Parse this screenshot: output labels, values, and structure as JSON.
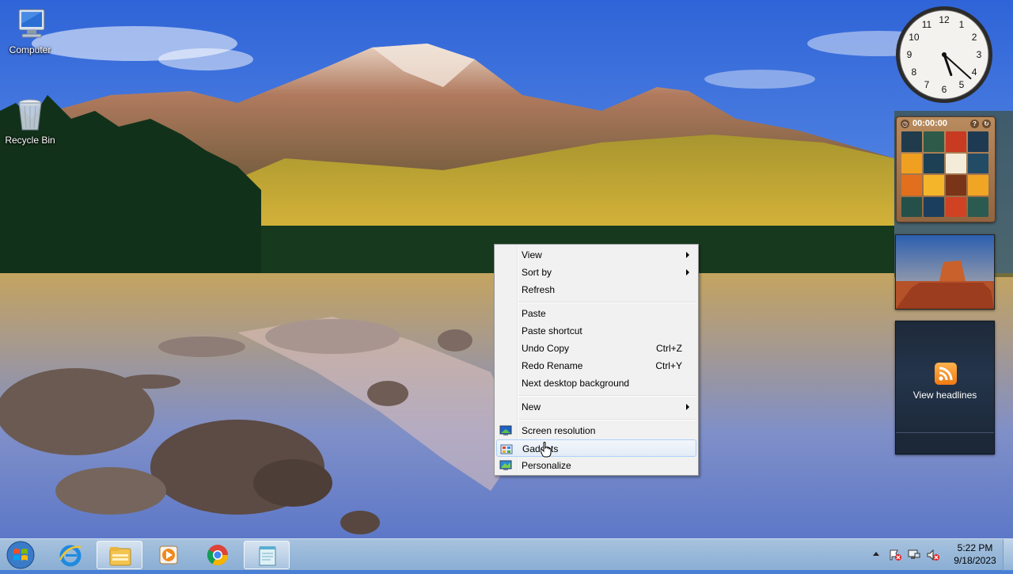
{
  "desktop": {
    "icons": [
      {
        "label": "Computer",
        "icon": "computer-icon"
      },
      {
        "label": "Recycle Bin",
        "icon": "recycle-bin-icon"
      }
    ]
  },
  "gadgets": {
    "clock": {
      "numbers": [
        "12",
        "1",
        "2",
        "3",
        "4",
        "5",
        "6",
        "7",
        "8",
        "9",
        "10",
        "11"
      ],
      "hour": 5,
      "minute": 22
    },
    "puzzle": {
      "timer": "00:00:00"
    },
    "feed": {
      "label": "View headlines",
      "icon": "rss-icon"
    }
  },
  "context_menu": {
    "items": [
      {
        "label": "View",
        "submenu": true
      },
      {
        "label": "Sort by",
        "submenu": true
      },
      {
        "label": "Refresh"
      },
      {
        "label": "Paste"
      },
      {
        "label": "Paste shortcut"
      },
      {
        "label": "Undo Copy",
        "shortcut": "Ctrl+Z"
      },
      {
        "label": "Redo Rename",
        "shortcut": "Ctrl+Y"
      },
      {
        "label": "Next desktop background"
      },
      {
        "label": "New",
        "submenu": true
      },
      {
        "label": "Screen resolution",
        "icon": "screen-resolution-icon"
      },
      {
        "label": "Gadgets",
        "icon": "gadgets-icon",
        "highlighted": true
      },
      {
        "label": "Personalize",
        "icon": "personalize-icon"
      }
    ]
  },
  "taskbar": {
    "apps": [
      {
        "name": "Internet Explorer",
        "icon": "internet-explorer-icon"
      },
      {
        "name": "Windows Explorer",
        "icon": "file-explorer-icon",
        "active": true
      },
      {
        "name": "Windows Media Player",
        "icon": "media-player-icon"
      },
      {
        "name": "Google Chrome",
        "icon": "chrome-icon"
      },
      {
        "name": "Notepad",
        "icon": "notepad-icon",
        "active": true
      }
    ],
    "time": "5:22 PM",
    "date": "9/18/2023"
  },
  "colors": {
    "menu_bg": "#f1f1f1",
    "menu_highlight": "#e3ecf7",
    "taskbar": "#98b8da"
  }
}
